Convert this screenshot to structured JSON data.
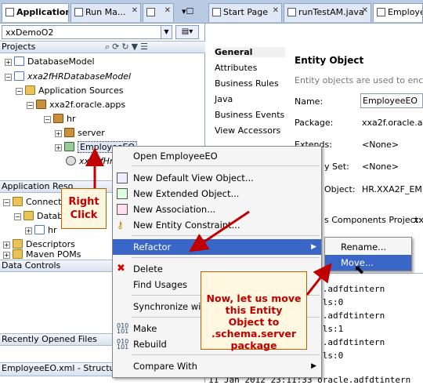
{
  "left_tabs": [
    {
      "label": "Application",
      "active": true
    },
    {
      "label": "Run Ma..."
    }
  ],
  "right_tabs": [
    {
      "label": "Start Page"
    },
    {
      "label": "runTestAM.java"
    },
    {
      "label": "Employee"
    }
  ],
  "app_combo": "xxDemoO2",
  "projects_header": "Projects",
  "tree": [
    {
      "label": "DatabaseModel",
      "icon": "project-icon"
    },
    {
      "label": "xxa2fHRDatabaseModel",
      "icon": "project-icon",
      "italic": true
    },
    {
      "label": "Application Sources",
      "icon": "folder-icon"
    },
    {
      "label": "xxa2f.oracle.apps",
      "icon": "package-icon"
    },
    {
      "label": "hr",
      "icon": "package-icon"
    },
    {
      "label": "server",
      "icon": "package-icon"
    },
    {
      "label": "EmployeeEO",
      "icon": "entity-object-icon",
      "selected": true
    },
    {
      "label": "xxa2fHr",
      "icon": "gear-icon",
      "italic": true
    }
  ],
  "app_resources_header": "Application Reso",
  "res_tree": [
    {
      "label": "Connection"
    },
    {
      "label": "Databa"
    },
    {
      "label": "hr"
    },
    {
      "label": "Descriptors"
    },
    {
      "label": "Maven POMs"
    }
  ],
  "data_controls_header": "Data Controls",
  "recent_files_header": "Recently Opened Files",
  "structure_header": "EmployeeEO.xml - Structure",
  "nav": [
    "General",
    "Attributes",
    "Business Rules",
    "Java",
    "Business Events",
    "View Accessors"
  ],
  "entity": {
    "heading": "Entity Object",
    "desc": "Entity objects are used to encapsu",
    "name_label": "Name:",
    "name_value": "EmployeeEO",
    "package_label": "Package:",
    "package_value": "xxa2f.oracle.app",
    "extends_label": "Extends:",
    "extends_value": "<None>",
    "keyset_label": "y Set:",
    "keyset_value": "<None>",
    "dbobj_label": "Object:",
    "dbobj_value": "HR.XXA2F_EMP_",
    "bcproj_label": "s Components Project:",
    "bcproj_value": "xxa"
  },
  "context_menu": [
    {
      "label": "Open EmployeeEO"
    },
    {
      "label": "New Default View Object..."
    },
    {
      "label": "New Extended Object..."
    },
    {
      "label": "New Association..."
    },
    {
      "label": "New Entity Constraint..."
    },
    {
      "label": "Refactor",
      "highlight": true,
      "submenu": true
    },
    {
      "label": "Delete"
    },
    {
      "label": "Find Usages"
    },
    {
      "label": "Synchronize with"
    },
    {
      "label": "Make"
    },
    {
      "label": "Rebuild"
    },
    {
      "label": "Compare With",
      "submenu": true
    }
  ],
  "submenu": [
    {
      "label": "Rename..."
    },
    {
      "label": "Move...",
      "highlight": true
    }
  ],
  "callout_right_click": "Right Click",
  "callout_move": "Now, let us move this Entity Object to .schema.server package",
  "log_lines": [
    "oracle.adfdtintern",
    "controls:0",
    "oracle.adfdtintern",
    "controls:1",
    "oracle.adfdtintern",
    "controls:0",
    "11 Jan 2012 23:11:33 oracle.adfdtintern"
  ],
  "colors": {
    "highlight": "#3a66c8",
    "callout_text": "#c00000",
    "arrow": "#c00000"
  }
}
